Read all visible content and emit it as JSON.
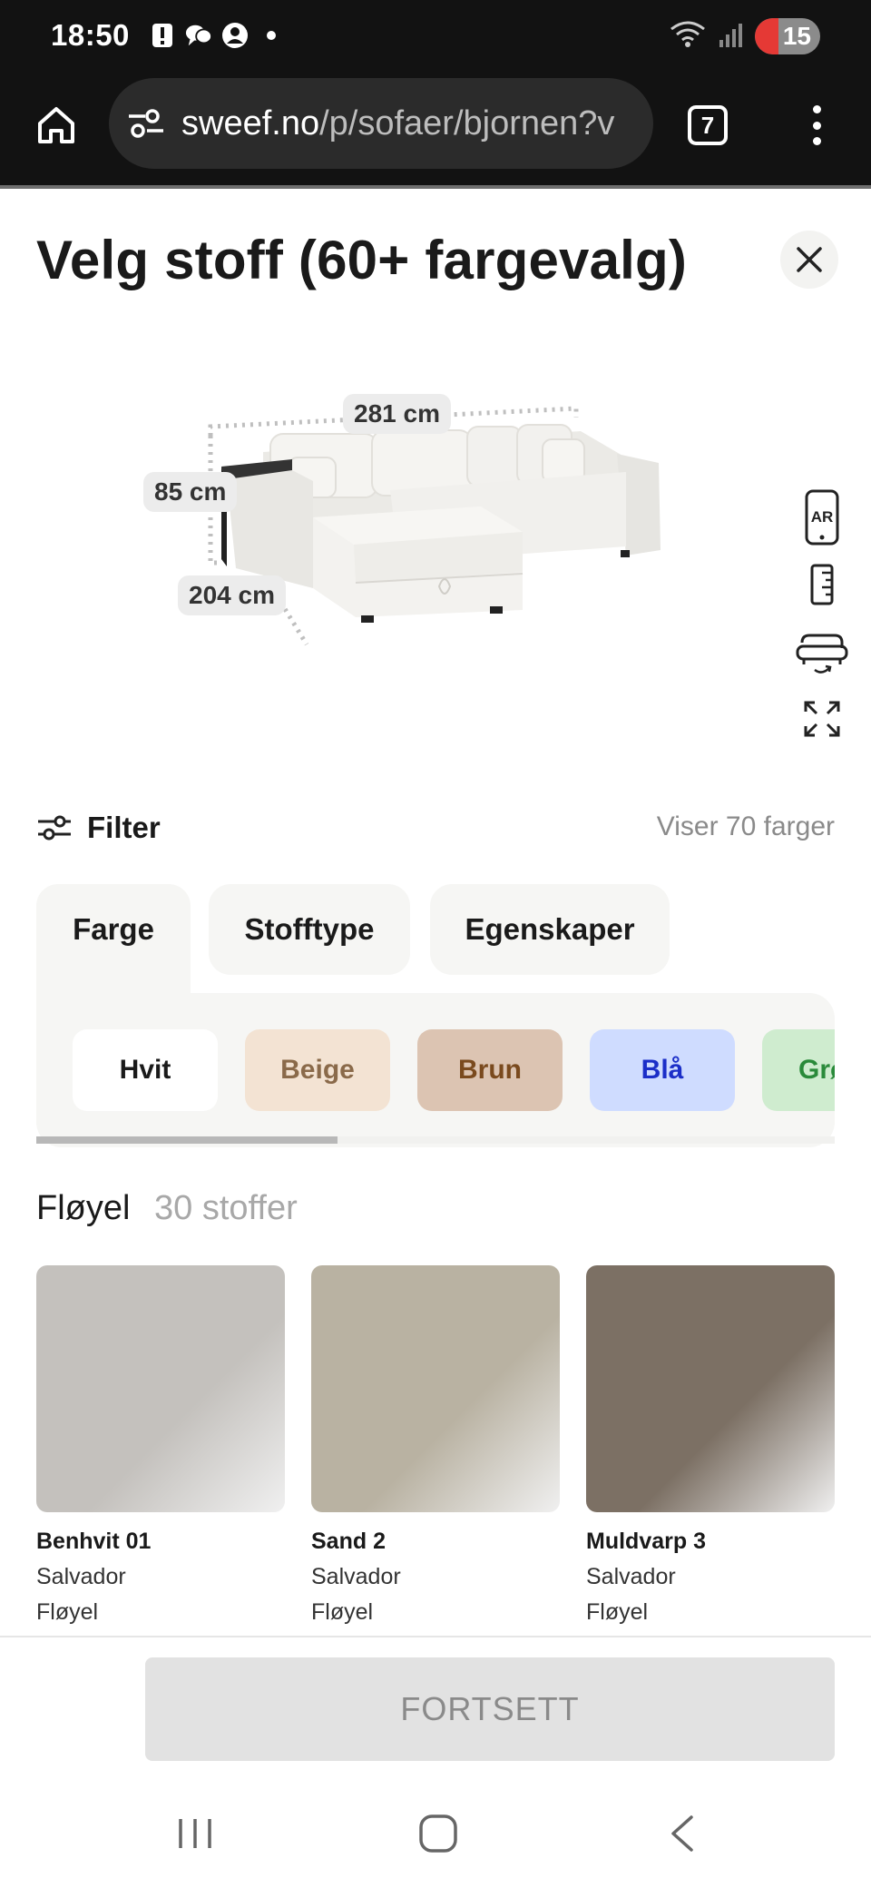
{
  "status": {
    "time": "18:50",
    "battery": "15"
  },
  "browser": {
    "url_host": "sweef.no",
    "url_path": "/p/sofaer/bjornen?v",
    "tab_count": "7"
  },
  "header": {
    "title": "Velg stoff (60+ fargevalg)"
  },
  "product": {
    "dim_width": "281 cm",
    "dim_height": "85 cm",
    "dim_depth": "204 cm",
    "ar_label": "AR"
  },
  "filter": {
    "label": "Filter",
    "count_text": "Viser 70 farger"
  },
  "tabs": [
    {
      "label": "Farge"
    },
    {
      "label": "Stofftype"
    },
    {
      "label": "Egenskaper"
    }
  ],
  "color_chips": [
    {
      "label": "Hvit",
      "bg": "#ffffff",
      "fg": "#1a1a1a"
    },
    {
      "label": "Beige",
      "bg": "#f3e3d3",
      "fg": "#8a6a4a"
    },
    {
      "label": "Brun",
      "bg": "#dcc4b2",
      "fg": "#7a4a1e"
    },
    {
      "label": "Blå",
      "bg": "#cfdcff",
      "fg": "#1b2ec8"
    },
    {
      "label": "Grønn",
      "bg": "#cfeccf",
      "fg": "#2a8a3a"
    }
  ],
  "section": {
    "title": "Fløyel",
    "count": "30 stoffer"
  },
  "fabrics": [
    {
      "name": "Benhvit 01",
      "collection": "Salvador",
      "type": "Fløyel",
      "color": "#c4c1bd"
    },
    {
      "name": "Sand 2",
      "collection": "Salvador",
      "type": "Fløyel",
      "color": "#b9b2a2"
    },
    {
      "name": "Muldvarp 3",
      "collection": "Salvador",
      "type": "Fløyel",
      "color": "#7c7064"
    }
  ],
  "footer": {
    "continue_label": "FORTSETT"
  }
}
